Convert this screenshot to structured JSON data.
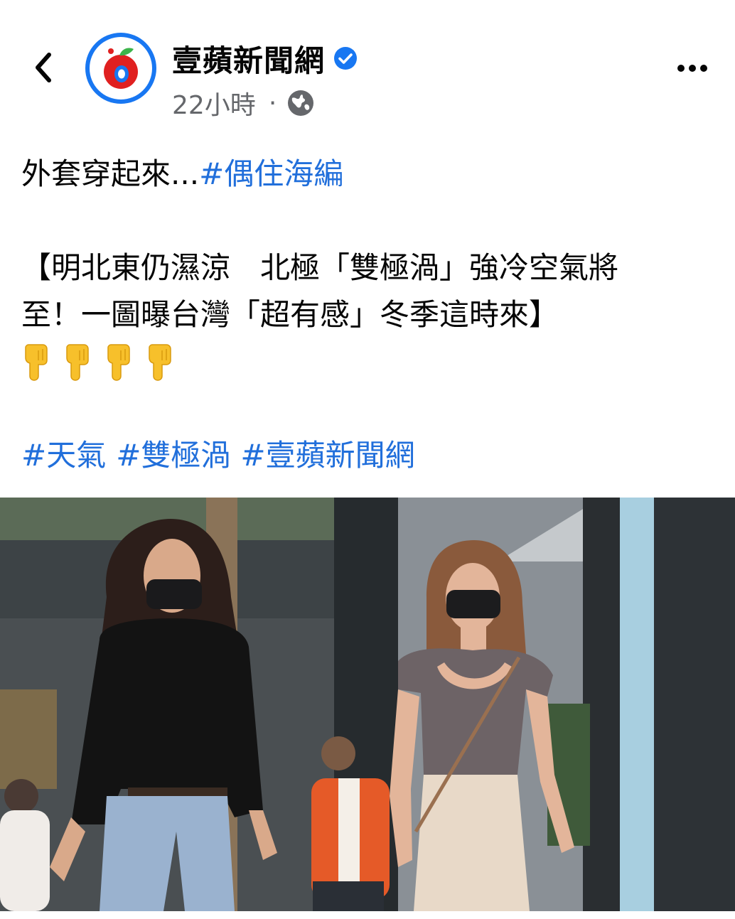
{
  "page": {
    "name": "壹蘋新聞網",
    "verified": true,
    "time_ago": "22小時",
    "separator": "·",
    "audience_icon": "globe-icon"
  },
  "header": {
    "back_icon": "chevron-left-icon",
    "more_icon": "more-horizontal-icon"
  },
  "post": {
    "intro_text": "外套穿起來...",
    "intro_hashtag": "#偶住海編",
    "headline_line1": "【明北東仍濕涼　北極「雙極渦」強冷空氣將",
    "headline_line2": "至！一圖曝台灣「超有感」冬季這時來】",
    "emoji_pointers": [
      "backhand-index-pointing-down-emoji",
      "backhand-index-pointing-down-emoji",
      "backhand-index-pointing-down-emoji",
      "backhand-index-pointing-down-emoji"
    ],
    "hashtags": [
      "#天氣",
      "#雙極渦",
      "#壹蘋新聞網"
    ]
  },
  "photo": {
    "subject": "two-women-wearing-black-masks-walking-street"
  },
  "colors": {
    "hashtag": "#216fdb",
    "brand_blue": "#1877f2",
    "brand_red": "#e02020",
    "secondary_text": "#65676b"
  }
}
